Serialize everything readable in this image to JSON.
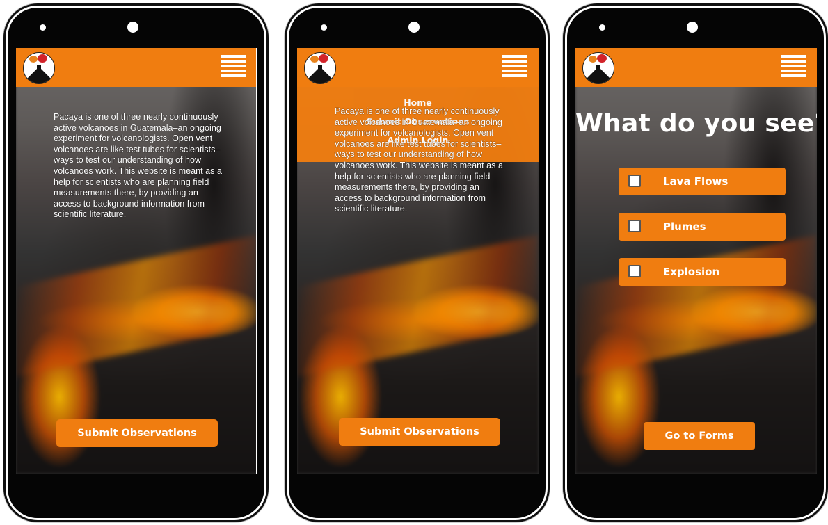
{
  "screens": [
    {
      "intro_text": "Pacaya is one of three nearly continuously active volcanoes in Guatemala–an ongoing experiment for volcanologists. Open vent volcanoes are like test tubes for scientists–ways to test our understanding of how volcanoes work. This website is meant as a help for scientists who are planning field measurements there, by providing an access to background information from scientific literature.",
      "submit_button": "Submit Observations"
    },
    {
      "menu": {
        "home": "Home",
        "submit": "Submit Observations",
        "admin": "Admin Login"
      },
      "intro_text": "Pacaya is one of three nearly continuously active volcanoes in Guatemala–an ongoing experiment for volcanologists. Open vent volcanoes are like test tubes for scientists–ways to test our understanding of how volcanoes work. This website is meant as a help for scientists who are planning field measurements there, by providing an access to background information from scientific literature.",
      "submit_button": "Submit Observations"
    },
    {
      "question": "What do you see?",
      "options": [
        {
          "label": "Lava Flows",
          "checked": false
        },
        {
          "label": "Plumes",
          "checked": false
        },
        {
          "label": "Explosion",
          "checked": false
        }
      ],
      "forms_button": "Go to Forms"
    }
  ],
  "icons": {
    "logo": "volcano-logo-icon",
    "menu": "hamburger-menu-icon",
    "checkbox": "checkbox-icon"
  },
  "colors": {
    "accent": "#f07d10",
    "text": "#ffffff",
    "phone_body": "#050505"
  }
}
